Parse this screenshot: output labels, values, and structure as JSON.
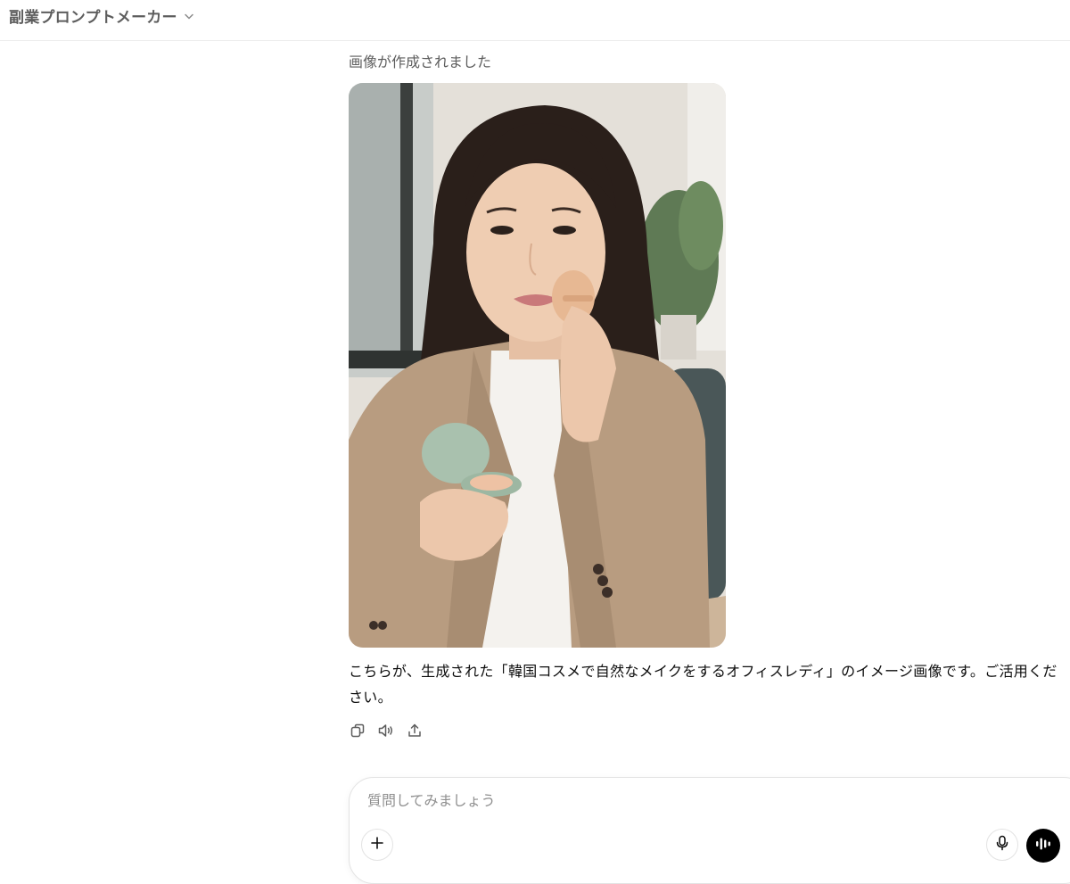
{
  "header": {
    "model_name": "副業プロンプトメーカー",
    "chevron_icon": "chevron-down-icon"
  },
  "conversation": {
    "status_text": "画像が作成されました",
    "image_alt": "韓国コスメで自然なメイクをするオフィスレディ",
    "reply_text": "こちらが、生成された「韓国コスメで自然なメイクをするオフィスレディ」のイメージ画像です。ご活用ください。",
    "actions": [
      {
        "name": "copy",
        "icon": "copy-icon"
      },
      {
        "name": "read-aloud",
        "icon": "speaker-icon"
      },
      {
        "name": "share",
        "icon": "share-icon"
      }
    ]
  },
  "composer": {
    "placeholder": "質問してみましょう",
    "value": "",
    "plus_icon": "plus-icon",
    "mic_icon": "microphone-icon",
    "voice_icon": "voice-mode-icon"
  },
  "colors": {
    "text_primary": "#0d0d0d",
    "text_secondary": "#5d5d5d",
    "placeholder": "#8f8f8f",
    "border": "#e3e3e3",
    "voice_button": "#000000"
  }
}
